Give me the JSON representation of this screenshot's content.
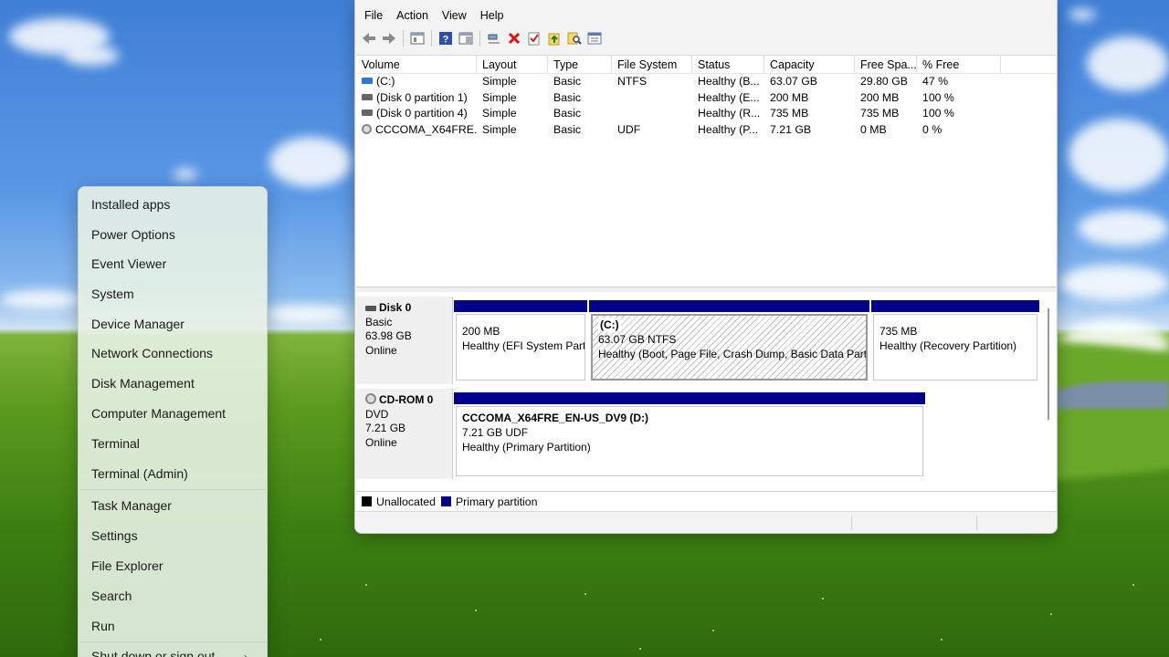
{
  "window": {
    "menu": [
      "File",
      "Action",
      "View",
      "Help"
    ],
    "toolbar_icons": [
      "back-arrow-icon",
      "forward-arrow-icon",
      "properties-icon",
      "help-icon",
      "show-hide-icon",
      "connect-icon",
      "delete-icon",
      "checkmark-icon",
      "upload-icon",
      "search-icon",
      "view-list-icon"
    ],
    "columns": [
      "Volume",
      "Layout",
      "Type",
      "File System",
      "Status",
      "Capacity",
      "Free Spa...",
      "% Free"
    ],
    "rows": [
      {
        "volume": "(C:)",
        "layout": "Simple",
        "type": "Basic",
        "fs": "NTFS",
        "status": "Healthy (B...",
        "capacity": "63.07 GB",
        "free": "29.80 GB",
        "pct": "47 %",
        "icon": "system-volume-icon"
      },
      {
        "volume": "(Disk 0 partition 1)",
        "layout": "Simple",
        "type": "Basic",
        "fs": "",
        "status": "Healthy (E...",
        "capacity": "200 MB",
        "free": "200 MB",
        "pct": "100 %",
        "icon": "volume-icon"
      },
      {
        "volume": "(Disk 0 partition 4)",
        "layout": "Simple",
        "type": "Basic",
        "fs": "",
        "status": "Healthy (R...",
        "capacity": "735 MB",
        "free": "735 MB",
        "pct": "100 %",
        "icon": "volume-icon"
      },
      {
        "volume": "CCCOMA_X64FRE...",
        "layout": "Simple",
        "type": "Basic",
        "fs": "UDF",
        "status": "Healthy (P...",
        "capacity": "7.21 GB",
        "free": "0 MB",
        "pct": "0 %",
        "icon": "cd-icon"
      }
    ],
    "disks": [
      {
        "name": "Disk 0",
        "kind": "Basic",
        "size": "63.98 GB",
        "state": "Online",
        "partitions": [
          {
            "title": "",
            "line1": "200 MB",
            "line2": "Healthy (EFI System Part"
          },
          {
            "title": "(C:)",
            "line1": "63.07 GB NTFS",
            "line2": "Healthy (Boot, Page File, Crash Dump, Basic Data Parti"
          },
          {
            "title": "",
            "line1": "735 MB",
            "line2": "Healthy (Recovery Partition)"
          }
        ]
      },
      {
        "name": "CD-ROM 0",
        "kind": "DVD",
        "size": "7.21 GB",
        "state": "Online",
        "partitions": [
          {
            "title": "CCCOMA_X64FRE_EN-US_DV9  (D:)",
            "line1": "7.21 GB UDF",
            "line2": "Healthy (Primary Partition)"
          }
        ]
      }
    ],
    "legend": [
      {
        "label": "Unallocated",
        "color": "#000000"
      },
      {
        "label": "Primary partition",
        "color": "#00008b"
      }
    ]
  },
  "winx_menu": {
    "items": [
      "Installed apps",
      "Power Options",
      "Event Viewer",
      "System",
      "Device Manager",
      "Network Connections",
      "Disk Management",
      "Computer Management",
      "Terminal",
      "Terminal (Admin)",
      "Task Manager",
      "Settings",
      "File Explorer",
      "Search",
      "Run",
      "Shut down or sign out"
    ],
    "submenu_icon": "chevron-right-icon"
  }
}
